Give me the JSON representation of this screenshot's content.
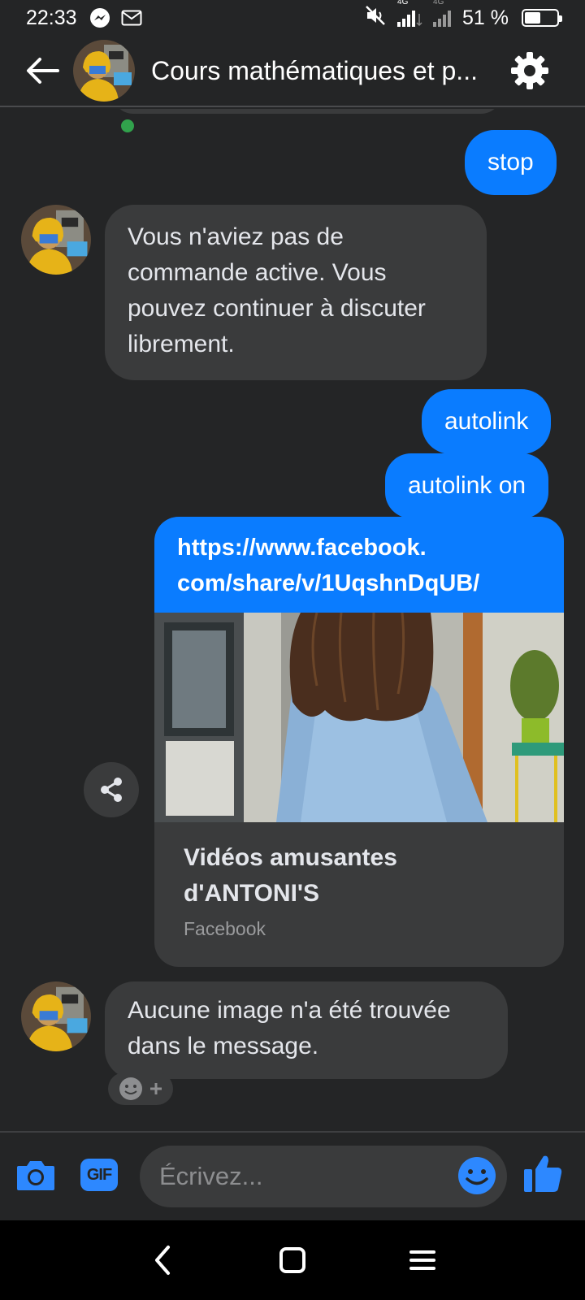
{
  "status_bar": {
    "time": "22:33",
    "network_top": "4G",
    "network_top_2": "4G",
    "battery_text": "51 %",
    "battery_level": 0.51
  },
  "header": {
    "title": "Cours mathématiques et p...",
    "online": true
  },
  "messages": [
    {
      "id": "m1",
      "direction": "outgoing",
      "text": "stop"
    },
    {
      "id": "m2",
      "direction": "incoming",
      "text": "Vous n'aviez pas de commande active. Vous pouvez continuer à discuter librement."
    },
    {
      "id": "m3",
      "direction": "outgoing",
      "text": "autolink"
    },
    {
      "id": "m4",
      "direction": "outgoing",
      "text": "autolink on"
    },
    {
      "id": "m5",
      "direction": "outgoing",
      "type": "link",
      "url_line1": "https://www.facebook.",
      "url_line2": "com/share/v/1UqshnDqUB/",
      "link_title_line1": "Vidéos amusantes",
      "link_title_line2": "d'ANTONI'S",
      "link_source": "Facebook"
    },
    {
      "id": "m6",
      "direction": "incoming",
      "text_line1": "Aucune image n'a été trouvée",
      "text_line2": "dans le message."
    }
  ],
  "composer": {
    "placeholder": "Écrivez...",
    "gif_label": "GIF"
  },
  "colors": {
    "background": "#242526",
    "outgoing_bubble": "#0a7cff",
    "incoming_bubble": "#3a3b3c",
    "accent": "#2d88ff",
    "online": "#31a24c"
  },
  "icons": [
    "back-arrow-icon",
    "settings-gear-icon",
    "share-icon",
    "camera-icon",
    "gif-icon",
    "emoji-icon",
    "thumbs-up-icon",
    "messenger-icon",
    "mail-icon",
    "mute-icon",
    "signal-icon"
  ]
}
